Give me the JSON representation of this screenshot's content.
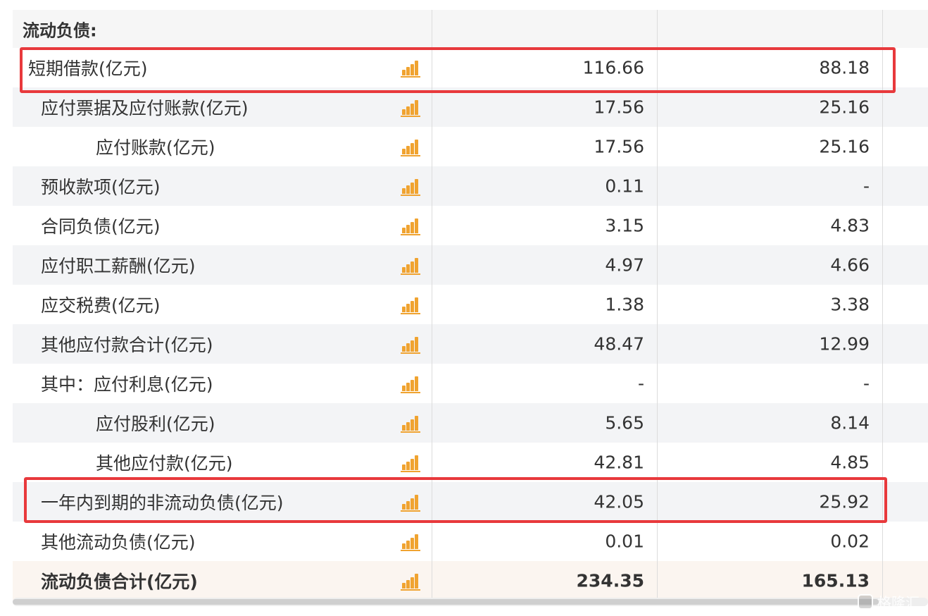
{
  "table": {
    "section_header": "流动负债:",
    "rows": [
      {
        "label": "短期借款(亿元)",
        "v1": "116.66",
        "v2": "88.18"
      },
      {
        "label": "应付票据及应付账款(亿元)",
        "v1": "17.56",
        "v2": "25.16"
      },
      {
        "label": "应付账款(亿元)",
        "v1": "17.56",
        "v2": "25.16"
      },
      {
        "label": "预收款项(亿元)",
        "v1": "0.11",
        "v2": "-"
      },
      {
        "label": "合同负债(亿元)",
        "v1": "3.15",
        "v2": "4.83"
      },
      {
        "label": "应付职工薪酬(亿元)",
        "v1": "4.97",
        "v2": "4.66"
      },
      {
        "label": "应交税费(亿元)",
        "v1": "1.38",
        "v2": "3.38"
      },
      {
        "label": "其他应付款合计(亿元)",
        "v1": "48.47",
        "v2": "12.99"
      },
      {
        "label": "其中：应付利息(亿元)",
        "v1": "-",
        "v2": "-"
      },
      {
        "label": "应付股利(亿元)",
        "v1": "5.65",
        "v2": "8.14"
      },
      {
        "label": "其他应付款(亿元)",
        "v1": "42.81",
        "v2": "4.85"
      },
      {
        "label": "一年内到期的非流动负债(亿元)",
        "v1": "42.05",
        "v2": "25.92"
      },
      {
        "label": "其他流动负债(亿元)",
        "v1": "0.01",
        "v2": "0.02"
      },
      {
        "label": "流动负债合计(亿元)",
        "v1": "234.35",
        "v2": "165.13"
      }
    ]
  },
  "icons": {
    "row_chart": "bar-chart-icon"
  },
  "colors": {
    "highlight": "#e8393c",
    "icon": "#f0a330"
  },
  "watermark": {
    "text": "格隆汇"
  }
}
